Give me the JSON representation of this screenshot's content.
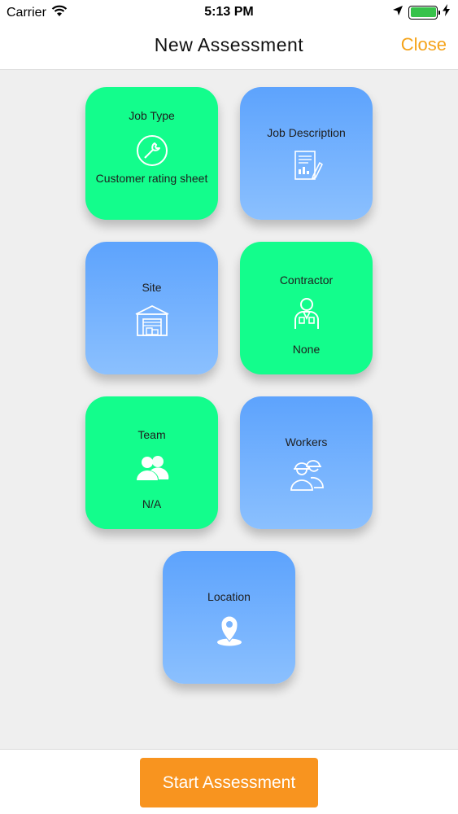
{
  "status_bar": {
    "carrier": "Carrier",
    "time": "5:13 PM",
    "battery_level": 1.0
  },
  "nav": {
    "title": "New Assessment",
    "close_label": "Close"
  },
  "cards": {
    "job_type": {
      "title": "Job Type",
      "value": "Customer rating sheet",
      "icon": "wrench-icon",
      "color": "#13fd8c"
    },
    "job_description": {
      "title": "Job Description",
      "icon": "document-pen-icon",
      "color": "#6aabfd"
    },
    "site": {
      "title": "Site",
      "icon": "warehouse-icon",
      "color": "#6aabfd"
    },
    "contractor": {
      "title": "Contractor",
      "value": "None",
      "icon": "worker-icon",
      "color": "#13fd8c"
    },
    "team": {
      "title": "Team",
      "value": "N/A",
      "icon": "team-icon",
      "color": "#13fd8c"
    },
    "workers": {
      "title": "Workers",
      "icon": "hardhat-workers-icon",
      "color": "#6aabfd"
    },
    "location": {
      "title": "Location",
      "icon": "location-pin-icon",
      "color": "#6aabfd"
    }
  },
  "footer": {
    "start_label": "Start Assessment",
    "start_color": "#f8941f"
  },
  "colors": {
    "accent": "#f5a31a",
    "green_card": "#13fd8c",
    "blue_card_top": "#5da3fd",
    "blue_card_bottom": "#8bc0fe"
  }
}
